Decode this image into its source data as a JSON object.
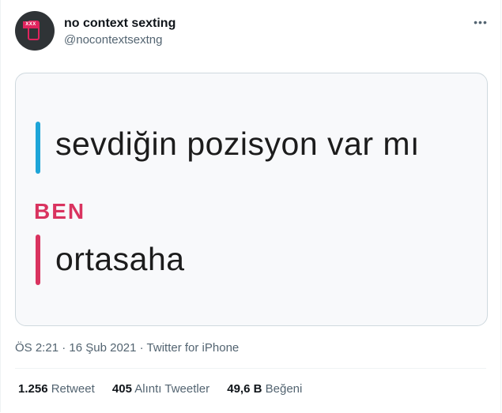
{
  "tweet": {
    "author": {
      "display_name": "no context sexting",
      "handle": "@nocontextsextng",
      "avatar_badge": "XXX",
      "avatar_icon": "phone-icon"
    },
    "more_label": "•••",
    "media": {
      "messages": [
        {
          "text": "sevdiğin pozisyon var mı",
          "bar_color": "#1ea5d8"
        },
        {
          "sender": "BEN",
          "text": "ortasaha",
          "bar_color": "#d9335f"
        }
      ]
    },
    "meta": {
      "time": "ÖS 2:21",
      "separator": " · ",
      "date": "16 Şub 2021",
      "source": "Twitter for iPhone"
    },
    "stats": [
      {
        "count": "1.256",
        "label": "Retweet"
      },
      {
        "count": "405",
        "label": "Alıntı Tweetler"
      },
      {
        "count": "49,6 B",
        "label": "Beğeni"
      }
    ]
  },
  "colors": {
    "accent_blue": "#1ea5d8",
    "accent_pink": "#d9335f",
    "text_secondary": "#536471"
  }
}
